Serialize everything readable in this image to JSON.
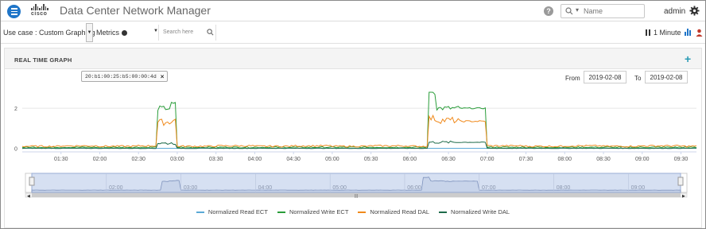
{
  "header": {
    "app_title": "Data Center Network Manager",
    "logo_word": "cisco",
    "help_glyph": "?",
    "search_placeholder": "Name",
    "user_name": "admin",
    "icons": [
      "menu-icon",
      "help-icon",
      "search-icon",
      "gear-icon"
    ]
  },
  "toolbar": {
    "use_case_label": "Use case : Custom Graphing",
    "metrics_label": "Metrics",
    "search_placeholder": "Search here",
    "interval_label": "1 Minute",
    "icons": [
      "pause-icon",
      "bar-chart-icon",
      "user-icon",
      "search-icon"
    ]
  },
  "panel": {
    "title": "REAL TIME GRAPH",
    "add_glyph": "+",
    "tag_label": "20:b1:00:25:b5:00:00:4d",
    "tag_close": "×",
    "from_label": "From",
    "from_date": "2019-02-08",
    "to_label": "To",
    "to_date": "2019-02-08"
  },
  "navigator": {
    "x_labels": [
      "02:00",
      "03:00",
      "04:00",
      "05:00",
      "06:00",
      "07:00",
      "08:00",
      "09:00"
    ],
    "handle_glyph": "⦙"
  },
  "colors": {
    "read_ect": "#5aa9d6",
    "write_ect": "#2a9d3a",
    "read_dal": "#f08a1c",
    "write_dal": "#1e6b4a",
    "accent": "#1f75c8"
  },
  "chart_data": {
    "type": "line",
    "x": [
      "01:00",
      "01:30",
      "02:00",
      "02:30",
      "02:45",
      "02:55",
      "03:00",
      "03:30",
      "04:00",
      "04:30",
      "05:00",
      "05:30",
      "06:00",
      "06:15",
      "06:20",
      "06:35",
      "07:00",
      "07:30",
      "08:00",
      "08:30",
      "09:00",
      "09:30"
    ],
    "x_tick_labels": [
      "01:30",
      "02:00",
      "02:30",
      "03:00",
      "03:30",
      "04:00",
      "04:30",
      "05:00",
      "05:30",
      "06:00",
      "06:30",
      "07:00",
      "07:30",
      "08:00",
      "08:30",
      "09:00",
      "09:30"
    ],
    "y_tick_labels": [
      "0",
      "2"
    ],
    "ylim": [
      -0.1,
      3.0
    ],
    "series": [
      {
        "name": "Normalized Read ECT",
        "values": [
          0.0,
          0.0,
          0.0,
          0.0,
          0.0,
          0.0,
          0.0,
          0.0,
          0.0,
          0.0,
          0.0,
          0.0,
          0.0,
          0.0,
          0.0,
          0.0,
          0.0,
          0.0,
          0.0,
          0.0,
          0.0,
          0.0
        ]
      },
      {
        "name": "Normalized Write ECT",
        "values": [
          0.05,
          0.05,
          0.05,
          0.05,
          2.0,
          2.2,
          0.05,
          0.05,
          0.05,
          0.05,
          0.05,
          0.05,
          0.05,
          2.8,
          2.0,
          2.0,
          0.05,
          0.05,
          0.05,
          0.05,
          0.05,
          0.05
        ]
      },
      {
        "name": "Normalized Read DAL",
        "values": [
          0.1,
          0.12,
          0.1,
          0.12,
          1.3,
          1.4,
          0.1,
          0.12,
          0.1,
          0.12,
          0.1,
          0.12,
          0.1,
          1.5,
          1.4,
          1.35,
          0.12,
          0.1,
          0.12,
          0.1,
          0.12,
          0.1
        ]
      },
      {
        "name": "Normalized Write DAL",
        "values": [
          0.0,
          0.0,
          0.0,
          0.0,
          0.25,
          0.25,
          0.0,
          0.0,
          0.0,
          0.0,
          0.0,
          0.0,
          0.0,
          0.3,
          0.3,
          0.3,
          0.0,
          0.0,
          0.0,
          0.0,
          0.0,
          0.0
        ]
      }
    ],
    "title": "",
    "xlabel": "",
    "ylabel": "",
    "grid": true,
    "legend": "bottom"
  }
}
